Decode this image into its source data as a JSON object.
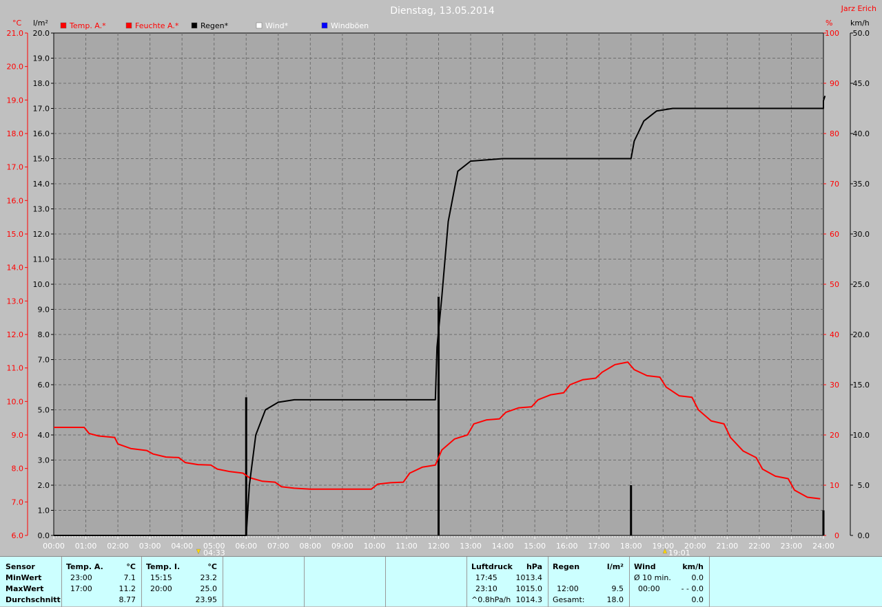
{
  "title": "Dienstag, 13.05.2014",
  "author": "Jarz Erich",
  "legend": [
    {
      "label": "Temp. A.*",
      "color": "#ff0000",
      "text_color": "#ff0000"
    },
    {
      "label": "Feuchte A.*",
      "color": "#ff0000",
      "text_color": "#ff0000"
    },
    {
      "label": "Regen*",
      "color": "#000000",
      "text_color": "#000000"
    },
    {
      "label": "Wind*",
      "color": "#ffffff",
      "text_color": "#ffffff"
    },
    {
      "label": "Windböen",
      "color": "#0000ff",
      "text_color": "#ffffff"
    }
  ],
  "sun_markers": {
    "sunrise": "04:33",
    "sunset": "19:01"
  },
  "chart_data": {
    "type": "line",
    "x_unit": "time",
    "x_ticks": [
      "00:00",
      "01:00",
      "02:00",
      "03:00",
      "04:00",
      "05:00",
      "06:00",
      "07:00",
      "08:00",
      "09:00",
      "10:00",
      "11:00",
      "12:00",
      "13:00",
      "14:00",
      "15:00",
      "16:00",
      "17:00",
      "18:00",
      "19:00",
      "20:00",
      "21:00",
      "22:00",
      "23:00",
      "24:00"
    ],
    "axes": {
      "temp": {
        "label": "°C",
        "range": [
          6.0,
          21.0
        ],
        "step": 1.0,
        "color": "#ff0000"
      },
      "rain": {
        "label": "l/m²",
        "range": [
          0.0,
          20.0
        ],
        "step": 1.0,
        "color": "#000000"
      },
      "humidity": {
        "label": "%",
        "range": [
          0,
          100
        ],
        "step": 10,
        "color": "#ff0000"
      },
      "wind": {
        "label": "km/h",
        "range": [
          0.0,
          50.0
        ],
        "step": 5.0,
        "color": "#000000"
      }
    },
    "grid": true,
    "series": [
      {
        "name": "Temp. A.*",
        "axis": "humidity",
        "color": "#ff0000",
        "points": [
          [
            0,
            21.5
          ],
          [
            0.95,
            21.5
          ],
          [
            1.1,
            20.3
          ],
          [
            1.4,
            19.8
          ],
          [
            1.9,
            19.5
          ],
          [
            2.0,
            18.2
          ],
          [
            2.4,
            17.3
          ],
          [
            2.9,
            16.9
          ],
          [
            3.1,
            16.2
          ],
          [
            3.5,
            15.6
          ],
          [
            3.9,
            15.5
          ],
          [
            4.1,
            14.5
          ],
          [
            4.5,
            14.1
          ],
          [
            4.9,
            14.0
          ],
          [
            5.1,
            13.2
          ],
          [
            5.5,
            12.7
          ],
          [
            5.9,
            12.4
          ],
          [
            6.1,
            11.5
          ],
          [
            6.5,
            10.8
          ],
          [
            6.9,
            10.6
          ],
          [
            7.1,
            9.7
          ],
          [
            7.5,
            9.4
          ],
          [
            8.0,
            9.2
          ],
          [
            8.9,
            9.2
          ],
          [
            9.9,
            9.2
          ],
          [
            10.1,
            10.2
          ],
          [
            10.5,
            10.5
          ],
          [
            10.9,
            10.6
          ],
          [
            11.1,
            12.4
          ],
          [
            11.5,
            13.6
          ],
          [
            11.9,
            14.0
          ],
          [
            12.1,
            17.0
          ],
          [
            12.5,
            19.2
          ],
          [
            12.9,
            20.0
          ],
          [
            13.1,
            22.2
          ],
          [
            13.5,
            23.0
          ],
          [
            13.9,
            23.2
          ],
          [
            14.1,
            24.5
          ],
          [
            14.5,
            25.4
          ],
          [
            14.9,
            25.6
          ],
          [
            15.1,
            27.0
          ],
          [
            15.5,
            28.0
          ],
          [
            15.9,
            28.4
          ],
          [
            16.1,
            30.0
          ],
          [
            16.5,
            31.0
          ],
          [
            16.9,
            31.3
          ],
          [
            17.1,
            32.5
          ],
          [
            17.5,
            34.0
          ],
          [
            17.9,
            34.5
          ],
          [
            18.1,
            33.0
          ],
          [
            18.5,
            31.8
          ],
          [
            18.9,
            31.5
          ],
          [
            19.1,
            29.5
          ],
          [
            19.5,
            27.8
          ],
          [
            19.9,
            27.5
          ],
          [
            20.1,
            25.0
          ],
          [
            20.5,
            22.8
          ],
          [
            20.9,
            22.2
          ],
          [
            21.1,
            19.5
          ],
          [
            21.5,
            16.8
          ],
          [
            21.9,
            15.5
          ],
          [
            22.1,
            13.2
          ],
          [
            22.5,
            11.8
          ],
          [
            22.9,
            11.3
          ],
          [
            23.1,
            9.0
          ],
          [
            23.5,
            7.6
          ],
          [
            23.9,
            7.3
          ]
        ]
      },
      {
        "name": "Regen*",
        "axis": "rain",
        "color": "#000000",
        "points": [
          [
            0,
            0
          ],
          [
            6.0,
            0
          ],
          [
            6.1,
            2.0
          ],
          [
            6.3,
            4.0
          ],
          [
            6.6,
            5.0
          ],
          [
            7.0,
            5.3
          ],
          [
            7.5,
            5.4
          ],
          [
            9.0,
            5.4
          ],
          [
            11.9,
            5.4
          ],
          [
            11.95,
            7.5
          ],
          [
            12.1,
            9.5
          ],
          [
            12.3,
            12.5
          ],
          [
            12.6,
            14.5
          ],
          [
            13.0,
            14.9
          ],
          [
            14.0,
            15.0
          ],
          [
            18.0,
            15.0
          ],
          [
            18.1,
            15.7
          ],
          [
            18.4,
            16.5
          ],
          [
            18.8,
            16.9
          ],
          [
            19.3,
            17.0
          ],
          [
            20.0,
            17.0
          ],
          [
            24.0,
            17.0
          ],
          [
            24.0,
            17.3
          ],
          [
            24.05,
            17.5
          ]
        ]
      }
    ],
    "rain_bars": [
      {
        "x": "06:00",
        "value": 5.5
      },
      {
        "x": "12:00",
        "value": 9.5
      },
      {
        "x": "18:00",
        "value": 2.0
      },
      {
        "x": "24:00",
        "value": 1.0
      }
    ]
  },
  "stats": {
    "sensor": {
      "header": "Sensor",
      "rows": [
        "MinWert",
        "MaxWert",
        "Durchschnitt"
      ]
    },
    "temp_a": {
      "header": "Temp. A.",
      "unit": "°C",
      "rows": [
        {
          "time": "23:00",
          "value": "7.1"
        },
        {
          "time": "17:00",
          "value": "11.2"
        },
        {
          "time": "",
          "value": "8.77"
        }
      ]
    },
    "temp_i": {
      "header": "Temp. I.",
      "unit": "°C",
      "rows": [
        {
          "time": "15:15",
          "value": "23.2"
        },
        {
          "time": "20:00",
          "value": "25.0"
        },
        {
          "time": "",
          "value": "23.95"
        }
      ]
    },
    "luftdruck": {
      "header": "Luftdruck",
      "unit": "hPa",
      "rows": [
        {
          "time": "17:45",
          "value": "1013.4"
        },
        {
          "time": "23:10",
          "value": "1015.0"
        },
        {
          "time": "^0.8hPa/h",
          "value": "1014.3"
        }
      ]
    },
    "regen": {
      "header": "Regen",
      "unit": "l/m²",
      "rows": [
        {
          "time": "",
          "value": ""
        },
        {
          "time": "12:00",
          "value": "9.5"
        },
        {
          "time": "Gesamt:",
          "value": "18.0"
        }
      ]
    },
    "wind": {
      "header": "Wind",
      "unit": "km/h",
      "rows": [
        {
          "time": "Ø 10 min.",
          "value": "0.0"
        },
        {
          "time": "00:00",
          "value": "- - 0.0"
        },
        {
          "time": "",
          "value": "0.0"
        }
      ]
    }
  }
}
